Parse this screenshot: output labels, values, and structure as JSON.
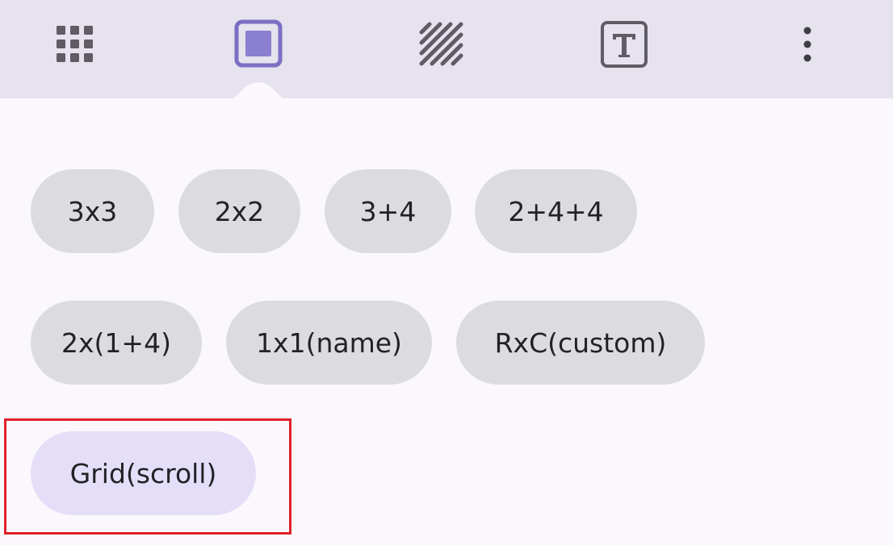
{
  "toolbar": {
    "tabs": [
      {
        "name": "grid-tab",
        "icon": "grid-dots-icon",
        "selected": false
      },
      {
        "name": "frame-tab",
        "icon": "square-frame-icon",
        "selected": true
      },
      {
        "name": "pattern-tab",
        "icon": "diagonal-stripes-icon",
        "selected": false
      },
      {
        "name": "text-tab",
        "icon": "text-box-icon",
        "selected": false
      },
      {
        "name": "more-tab",
        "icon": "more-vertical-icon",
        "selected": false
      }
    ],
    "colors": {
      "background": "#e6e2ee",
      "icon": "#5f5c66",
      "selected_icon": "#7b6fc4"
    }
  },
  "layouts": {
    "row1": [
      "3x3",
      "2x2",
      "3+4",
      "2+4+4"
    ],
    "row2": [
      "2x(1+4)",
      "1x1(name)",
      "RxC(custom)"
    ],
    "row3": [
      "Grid(scroll)"
    ],
    "selected": "Grid(scroll)"
  },
  "colors": {
    "chip": "#dcdbdf",
    "chip_selected": "#e4def8",
    "highlight": "#e0202a"
  }
}
